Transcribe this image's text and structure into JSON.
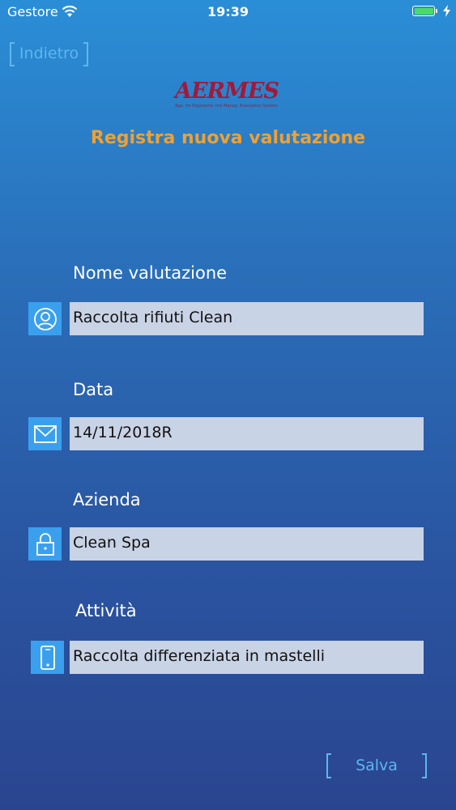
{
  "status_bar": {
    "carrier": "Gestore",
    "time": "19:39",
    "wifi_icon": "wifi-icon",
    "battery_icon": "battery-icon",
    "battery_color": "#4cd964"
  },
  "nav": {
    "back_label": "Indietro"
  },
  "logo": {
    "word": "AERMES",
    "tagline": "App. for Ergonomic risk Manag. Evaluation System"
  },
  "title": "Registra nuova valutazione",
  "form": {
    "fields": [
      {
        "label": "Nome valutazione",
        "value": "Raccolta rifiuti Clean",
        "icon": "user-icon"
      },
      {
        "label": "Data",
        "value": "14/11/2018R",
        "icon": "mail-icon"
      },
      {
        "label": "Azienda",
        "value": "Clean Spa",
        "icon": "lock-icon"
      },
      {
        "label": "Attività",
        "value": "Raccolta differenziata in mastelli",
        "icon": "phone-icon"
      }
    ]
  },
  "actions": {
    "save_label": "Salva"
  },
  "colors": {
    "accent": "#5fb6ef",
    "title": "#f0a030",
    "icon_bg": "#3aa0ee",
    "input_bg": "#c9d3e6"
  }
}
